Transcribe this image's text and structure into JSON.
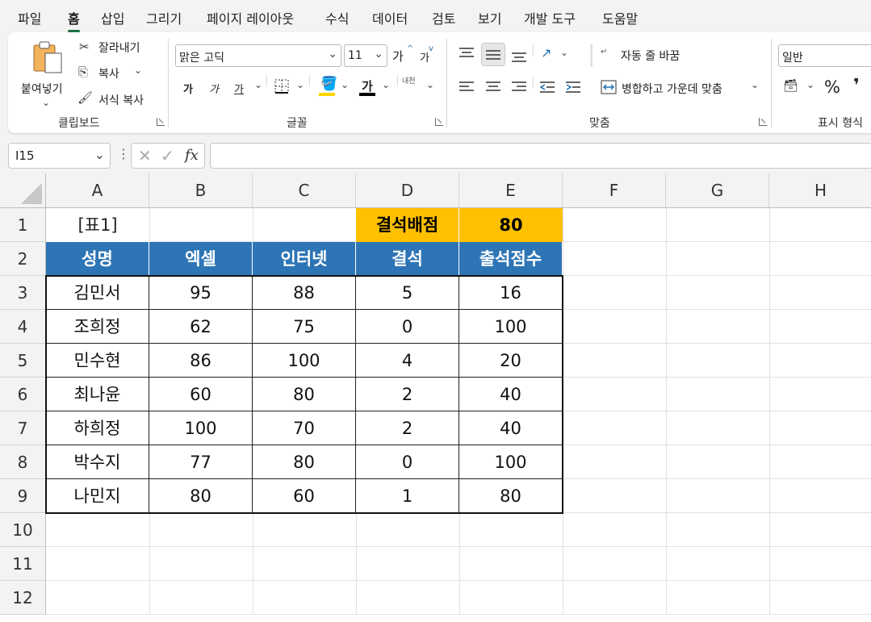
{
  "menu": {
    "tabs": [
      "파일",
      "홈",
      "삽입",
      "그리기",
      "페이지 레이아웃",
      "수식",
      "데이터",
      "검토",
      "보기",
      "개발 도구",
      "도움말"
    ],
    "active": "홈"
  },
  "ribbon": {
    "clipboard": {
      "paste": "붙여넣기",
      "cut": "잘라내기",
      "copy": "복사",
      "format_painter": "서식 복사",
      "label": "클립보드"
    },
    "font": {
      "name": "맑은 고딕",
      "size": "11",
      "grow": "가",
      "shrink": "가",
      "bold": "가",
      "italic": "가",
      "underline": "가",
      "font_color_glyph": "가",
      "phonetic": "내천",
      "label": "글꼴",
      "fill_color": "#ffd500",
      "text_color": "#000000"
    },
    "alignment": {
      "wrap_text": "자동 줄 바꿈",
      "merge_center": "병합하고 가운데 맞춤",
      "label": "맞춤"
    },
    "number": {
      "format": "일반",
      "percent": "%",
      "comma": "❜",
      "label": "표시 형식"
    }
  },
  "formula_bar": {
    "name_box": "I15",
    "fx": "fx",
    "formula": ""
  },
  "sheet": {
    "columns": [
      "A",
      "B",
      "C",
      "D",
      "E",
      "F",
      "G",
      "H"
    ],
    "rows": [
      "1",
      "2",
      "3",
      "4",
      "5",
      "6",
      "7",
      "8",
      "9",
      "10",
      "11",
      "12"
    ],
    "title_cell": "[표1]",
    "absence_label": "결석배점",
    "absence_value": "80",
    "headers": [
      "성명",
      "엑셀",
      "인터넷",
      "결석",
      "출석점수"
    ],
    "records": [
      [
        "김민서",
        "95",
        "88",
        "5",
        "16"
      ],
      [
        "조희정",
        "62",
        "75",
        "0",
        "100"
      ],
      [
        "민수현",
        "86",
        "100",
        "4",
        "20"
      ],
      [
        "최나윤",
        "60",
        "80",
        "2",
        "40"
      ],
      [
        "하희정",
        "100",
        "70",
        "2",
        "40"
      ],
      [
        "박수지",
        "77",
        "80",
        "0",
        "100"
      ],
      [
        "나민지",
        "80",
        "60",
        "1",
        "80"
      ]
    ],
    "colors": {
      "header_fill": "#2e75b6",
      "highlight_fill": "#ffc000"
    }
  }
}
